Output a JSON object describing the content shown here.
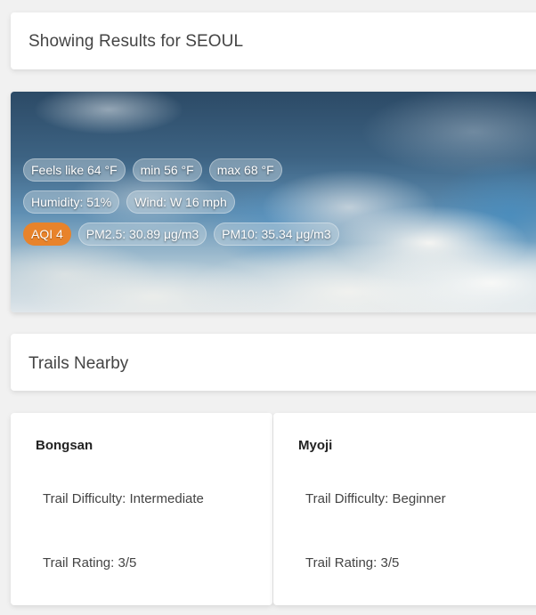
{
  "header": {
    "title": "Showing Results for SEOUL"
  },
  "weather": {
    "feels_like": "Feels like 64 °F",
    "min": "min 56 °F",
    "max": "max 68 °F",
    "humidity": "Humidity: 51%",
    "wind": "Wind: W 16 mph",
    "aqi": "AQI 4",
    "pm25": "PM2.5: 30.89 μg/m3",
    "pm10": "PM10: 35.34 μg/m3",
    "aqi_color": "#e8832b"
  },
  "trails_section": {
    "title": "Trails Nearby"
  },
  "trails": [
    {
      "name": "Bongsan",
      "difficulty": "Trail Difficulty: Intermediate",
      "rating": "Trail Rating: 3/5"
    },
    {
      "name": "Myoji",
      "difficulty": "Trail Difficulty: Beginner",
      "rating": "Trail Rating: 3/5"
    }
  ]
}
